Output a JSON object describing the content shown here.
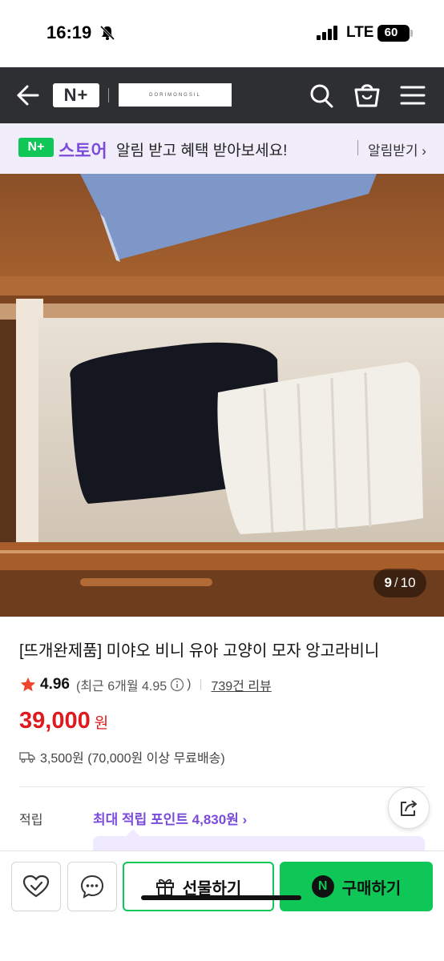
{
  "status_bar": {
    "time": "16:19",
    "network": "LTE",
    "battery": "60"
  },
  "nav": {
    "logo": "N+",
    "brand_text": "DORIMONGSIL"
  },
  "store_banner": {
    "badge": "N+",
    "name": "스토어",
    "message": "알림 받고 혜택 받아보세요!",
    "cta": "알림받기 ›"
  },
  "gallery": {
    "current": "9",
    "separator": "/",
    "total": "10"
  },
  "product": {
    "title": "[뜨개완제품] 미야오 비니 유아 고양이 모자 앙고라비니",
    "rating": "4.96",
    "recent_rating_label": "(최근 6개월 4.95",
    "recent_rating_close": ")",
    "review_link": "739건 리뷰",
    "price": "39,000",
    "price_unit": "원",
    "shipping": "3,500원 (70,000원 이상 무료배송)"
  },
  "points": {
    "label": "적립",
    "link": "최대 적립 포인트 4,830원 ›"
  },
  "actions": {
    "gift": "선물하기",
    "buy": "구매하기",
    "npay_letter": "N"
  },
  "colors": {
    "naver_green": "#0fc756",
    "store_purple": "#7b4cdc",
    "price_red": "#e0191e",
    "nav_dark": "#2e2f33"
  },
  "icons": [
    "back-arrow-icon",
    "search-icon",
    "cart-icon",
    "menu-icon",
    "bell-muted-icon",
    "signal-icon",
    "star-icon",
    "info-icon",
    "truck-icon",
    "share-icon",
    "heart-check-icon",
    "chat-icon",
    "gift-icon",
    "npay-icon"
  ]
}
